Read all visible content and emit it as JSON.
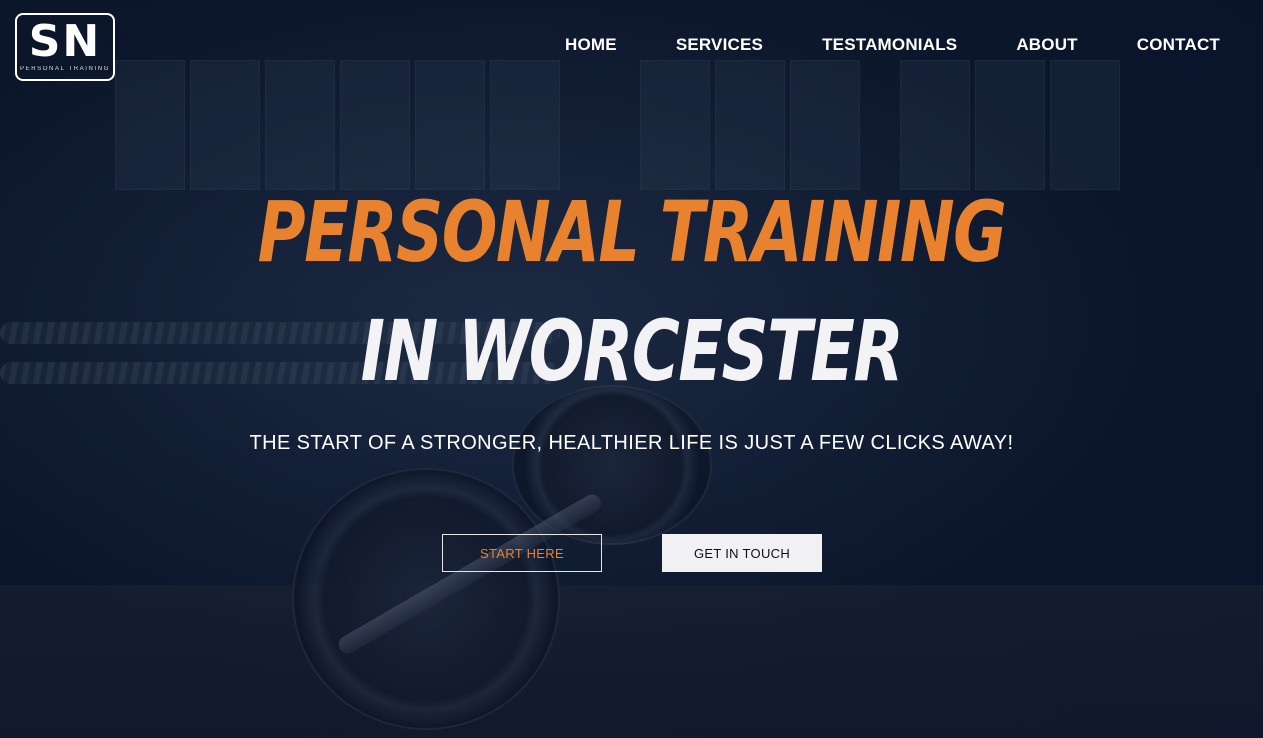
{
  "brand": {
    "logo_mark": "SN",
    "logo_subtitle": "PERSONAL TRAINING"
  },
  "nav": {
    "items": [
      {
        "label": "HOME"
      },
      {
        "label": "SERVICES"
      },
      {
        "label": "TESTAMONIALS"
      },
      {
        "label": "ABOUT"
      },
      {
        "label": "CONTACT"
      }
    ]
  },
  "hero": {
    "headline_line1": "PERSONAL TRAINING",
    "headline_line2": "IN WORCESTER",
    "tagline": "THE START OF A STRONGER, HEALTHIER LIFE IS JUST A FEW CLICKS AWAY!",
    "primary_button": "START HERE",
    "secondary_button": "GET IN TOUCH"
  },
  "colors": {
    "accent": "#e8822f",
    "background": "#0b1629",
    "text": "#ffffff"
  }
}
